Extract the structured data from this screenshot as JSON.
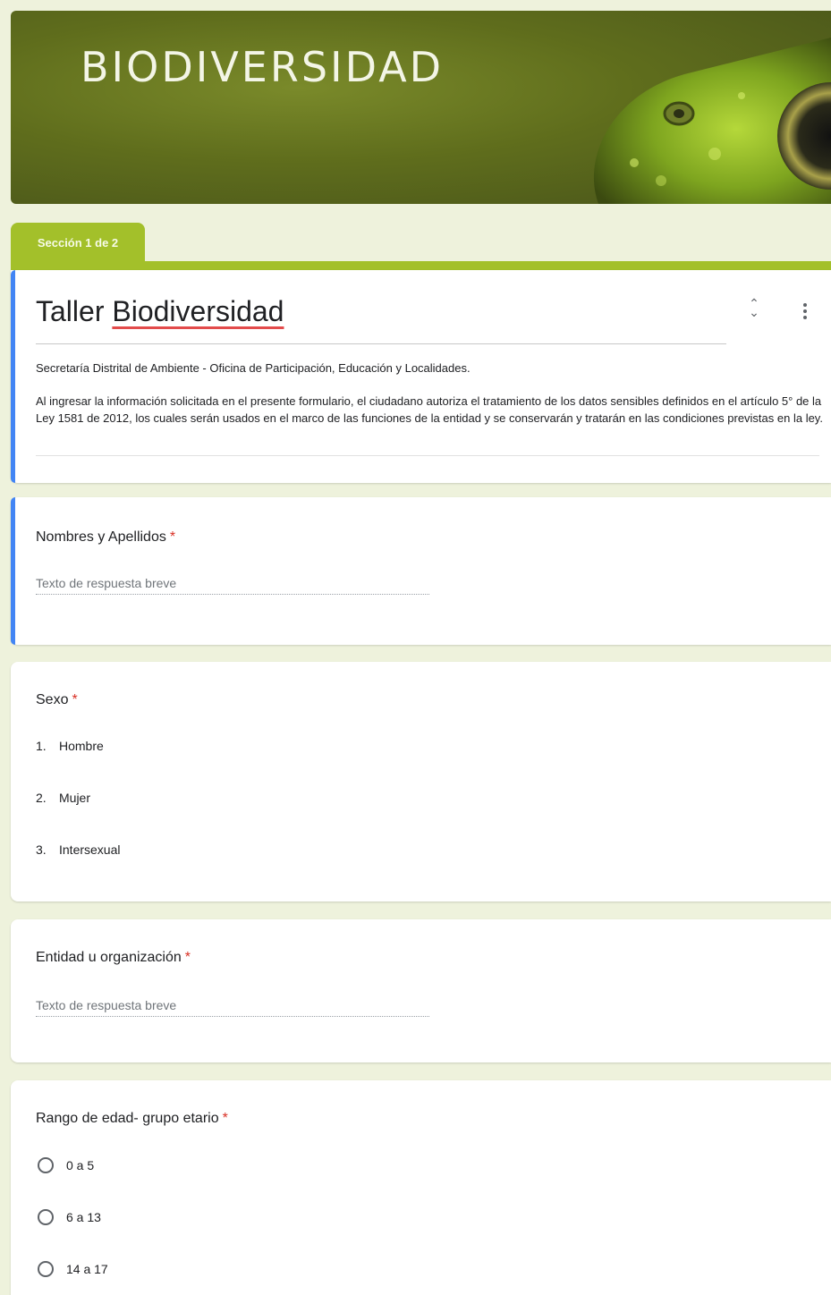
{
  "banner": {
    "title": "BIODIVERSIDAD"
  },
  "section_tab": {
    "label": "Sección 1 de 2"
  },
  "header": {
    "title_plain": "Taller ",
    "title_underlined": "Biodiversidad",
    "description_line1": "Secretaría Distrital de Ambiente - Oficina de Participación, Educación y Localidades.",
    "description_line2": "Al ingresar la información solicitada en el presente formulario, el ciudadano autoriza el tratamiento de los datos sensibles definidos en el artículo 5° de la Ley 1581 de 2012, los cuales serán usados en el marco de las funciones de la entidad y se conservarán y tratarán en las condiciones previstas en la ley."
  },
  "questions": {
    "nombres": {
      "label": "Nombres y Apellidos",
      "required_mark": "*",
      "placeholder": "Texto de respuesta breve"
    },
    "sexo": {
      "label": "Sexo",
      "required_mark": "*",
      "options": [
        {
          "num": "1.",
          "label": "Hombre"
        },
        {
          "num": "2.",
          "label": "Mujer"
        },
        {
          "num": "3.",
          "label": "Intersexual"
        }
      ]
    },
    "entidad": {
      "label": "Entidad u organización",
      "required_mark": "*",
      "placeholder": "Texto de respuesta breve"
    },
    "edad": {
      "label": "Rango de edad- grupo etario",
      "required_mark": "*",
      "options": [
        {
          "label": "0 a 5"
        },
        {
          "label": "6 a 13"
        },
        {
          "label": "14 a 17"
        }
      ]
    }
  },
  "colors": {
    "accent": "#a3c02a",
    "active_border": "#4285f4",
    "required": "#d93025",
    "background": "#eef2dc"
  }
}
